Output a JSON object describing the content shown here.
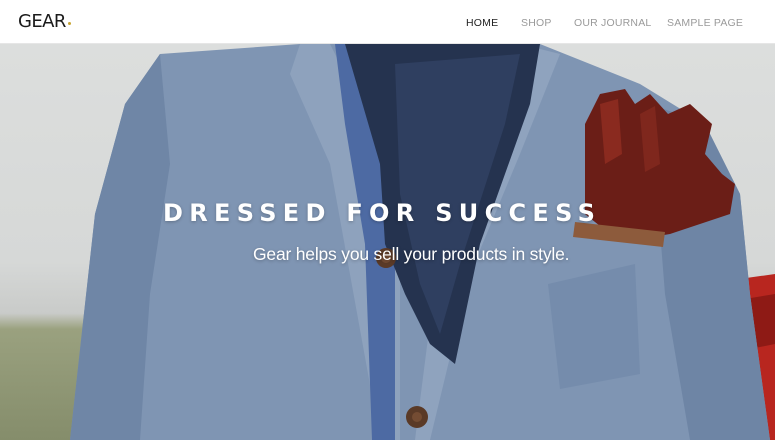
{
  "header": {
    "logo_text": "GEAR",
    "logo_dot_color": "#c9a634",
    "nav": [
      {
        "label": "HOME",
        "active": true
      },
      {
        "label": "SHOP",
        "active": false
      },
      {
        "label": "OUR JOURNAL",
        "active": false
      },
      {
        "label": "SAMPLE PAGE",
        "active": false
      }
    ]
  },
  "hero": {
    "title": "DRESSED FOR SUCCESS",
    "subtitle": "Gear helps you sell your products in style."
  }
}
